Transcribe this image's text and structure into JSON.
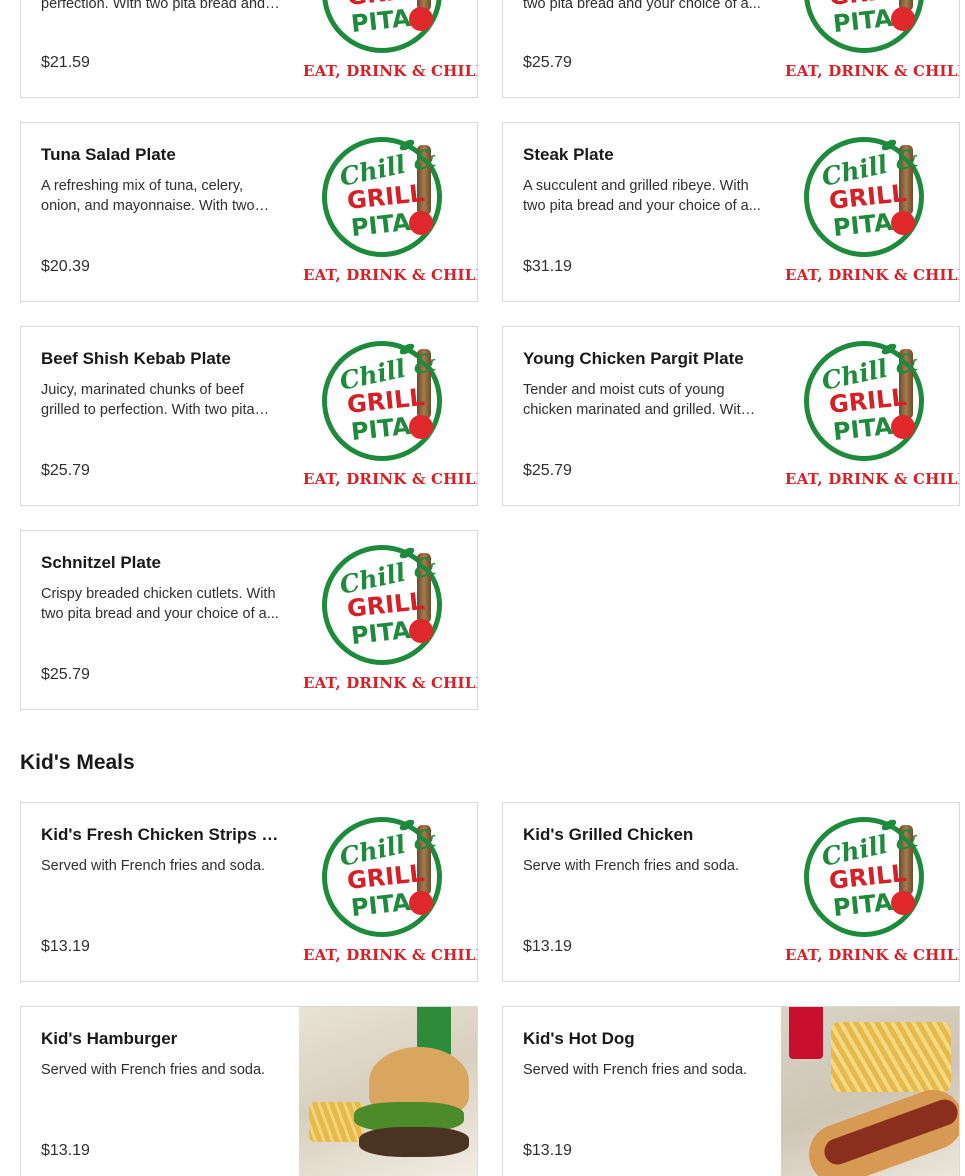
{
  "logo": {
    "chill": "Chill &",
    "grill": "GRILL",
    "pita": "PITA",
    "tagline": "EAT, DRINK & CHILL"
  },
  "plates": [
    {
      "name": "",
      "description": "perfection. With two pita bread and your choice of a...",
      "price": "$21.59",
      "image": "logo"
    },
    {
      "name": "",
      "description": "two pita bread and your choice of a...",
      "price": "$25.79",
      "image": "logo"
    },
    {
      "name": "Tuna Salad Plate",
      "description": "A refreshing mix of tuna, celery, onion, and mayonnaise. With two pita bread and your choice of a...",
      "price": "$20.39",
      "image": "logo"
    },
    {
      "name": "Steak Plate",
      "description": "A succulent and grilled ribeye. With two pita bread and your choice of a...",
      "price": "$31.19",
      "image": "logo"
    },
    {
      "name": "Beef Shish Kebab Plate",
      "description": "Juicy, marinated chunks of beef grilled to perfection. With two pita bread...",
      "price": "$25.79",
      "image": "logo"
    },
    {
      "name": "Young Chicken Pargit Plate",
      "description": "Tender and moist cuts of young chicken marinated and grilled. With two...",
      "price": "$25.79",
      "image": "logo"
    },
    {
      "name": "Schnitzel Plate",
      "description": "Crispy breaded chicken cutlets. With two pita bread and your choice of a...",
      "price": "$25.79",
      "image": "logo"
    }
  ],
  "kids_section": {
    "title": "Kid's Meals",
    "items": [
      {
        "name": "Kid's Fresh Chicken Strips (...",
        "description": "Served with French fries and soda.",
        "price": "$13.19",
        "image": "logo"
      },
      {
        "name": "Kid's Grilled Chicken",
        "description": "Serve with French fries and soda.",
        "price": "$13.19",
        "image": "logo"
      },
      {
        "name": "Kid's Hamburger",
        "description": "Served with French fries and soda.",
        "price": "$13.19",
        "image": "hamburger-photo"
      },
      {
        "name": "Kid's Hot Dog",
        "description": "Served with French fries and soda.",
        "price": "$13.19",
        "image": "hotdog-photo"
      }
    ]
  },
  "colors": {
    "brand_green": "#1e8a3c",
    "brand_red": "#d62027",
    "card_border": "#d9d9d9"
  }
}
